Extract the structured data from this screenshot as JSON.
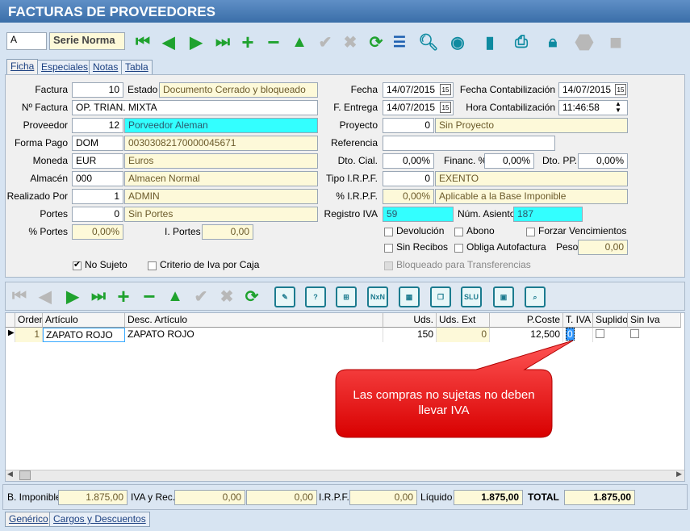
{
  "window": {
    "title": "FACTURAS DE PROVEEDORES"
  },
  "toolbar": {
    "serie_code": "A",
    "serie_label": "Serie Norma"
  },
  "tabs": [
    "Ficha",
    "Especiales",
    "Notas",
    "Tabla"
  ],
  "form": {
    "factura_label": "Factura",
    "factura": "10",
    "estado_label": "Estado",
    "estado": "Documento Cerrado y bloqueado",
    "nfactura_label": "Nº Factura",
    "nfactura": "OP. TRIAN. MIXTA",
    "proveedor_label": "Proveedor",
    "proveedor_code": "12",
    "proveedor_name": "Porveedor Aleman",
    "formapago_label": "Forma Pago",
    "formapago_code": "DOM",
    "formapago_desc": "00303082170000045671",
    "moneda_label": "Moneda",
    "moneda_code": "EUR",
    "moneda_desc": "Euros",
    "almacen_label": "Almacén",
    "almacen_code": "000",
    "almacen_desc": "Almacen Normal",
    "realizado_label": "Realizado Por",
    "realizado_code": "1",
    "realizado_desc": "ADMIN",
    "portes_label": "Portes",
    "portes_code": "0",
    "portes_desc": "Sin Portes",
    "pct_portes_label": "% Portes",
    "pct_portes": "0,00%",
    "i_portes_label": "I. Portes",
    "i_portes": "0,00",
    "fecha_label": "Fecha",
    "fecha": "14/07/2015",
    "fecha_cont_label": "Fecha Contabilización",
    "fecha_cont": "14/07/2015",
    "fentrega_label": "F. Entrega",
    "fentrega": "14/07/2015",
    "hora_cont_label": "Hora Contabilización",
    "hora_cont": "11:46:58",
    "proyecto_label": "Proyecto",
    "proyecto_code": "0",
    "proyecto_desc": "Sin Proyecto",
    "referencia_label": "Referencia",
    "referencia": "",
    "dto_cial_label": "Dto. Cial.",
    "dto_cial": "0,00%",
    "financ_label": "Financ. %",
    "financ": "0,00%",
    "dto_pp_label": "Dto. PP.",
    "dto_pp": "0,00%",
    "tipo_irpf_label": "Tipo I.R.P.F.",
    "tipo_irpf_code": "0",
    "tipo_irpf_desc": "EXENTO",
    "pct_irpf_label": "% I.R.P.F.",
    "pct_irpf": "0,00%",
    "pct_irpf_desc": "Aplicable a la Base Imponible",
    "registro_iva_label": "Registro IVA",
    "registro_iva": "59",
    "num_asiento_label": "Núm. Asiento",
    "num_asiento": "187",
    "devolucion_label": "Devolución",
    "abono_label": "Abono",
    "forzar_label": "Forzar Vencimientos",
    "sin_recibos_label": "Sin Recibos",
    "obliga_label": "Obliga Autofactura",
    "peso_label": "Peso",
    "peso": "0,00",
    "no_sujeto_label": "No Sujeto",
    "criterio_label": "Criterio de Iva por Caja",
    "bloqueado_label": "Bloqueado para Transferencias"
  },
  "grid": {
    "headers": [
      "Orden",
      "Artículo",
      "Desc. Artículo",
      "Uds.",
      "Uds. Ext",
      "P.Coste",
      "T. IVA",
      "Suplido",
      "Sin Iva"
    ],
    "row": {
      "orden": "1",
      "articulo": "ZAPATO ROJO",
      "desc": "ZAPATO ROJO",
      "uds": "150",
      "uds_ext": "0",
      "pcoste": "12,500",
      "tiva": "0"
    }
  },
  "callout": {
    "text": "Las compras no sujetas no deben llevar IVA"
  },
  "totals": {
    "base_label": "B. Imponible",
    "base": "1.875,00",
    "iva_label": "IVA y Rec.",
    "iva": "0,00",
    "rec": "0,00",
    "irpf_label": "I.R.P.F.",
    "irpf": "0,00",
    "liquido_label": "Líquido",
    "liquido": "1.875,00",
    "total_label": "TOTAL",
    "total": "1.875,00"
  },
  "bottom_tabs": [
    "Genérico",
    "Cargos y Descuentos"
  ]
}
